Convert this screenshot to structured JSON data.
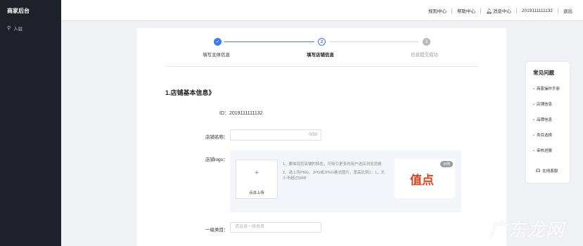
{
  "sidebar": {
    "brand": "商家后台",
    "nav_item": {
      "label": "入驻",
      "icon": "key-icon"
    }
  },
  "topbar": {
    "rules_center": "规则中心",
    "help_center": "帮助中心",
    "message_center": "消息中心",
    "user_phone": "2019111111132",
    "logout": "退出"
  },
  "steps": [
    {
      "index": "✓",
      "label": "填写主体信息",
      "status": "done"
    },
    {
      "index": "2",
      "label": "填写店铺信息",
      "status": "active"
    },
    {
      "index": "3",
      "label": "信息提交成功",
      "status": "pending"
    }
  ],
  "form": {
    "section_title": "1.店铺基本信息》",
    "id_label": "ID：",
    "id_value": "2019111111132",
    "shop_name_label": "店铺名称：",
    "shop_name_value": "",
    "shop_name_counter": "0/30",
    "logo_label": "店铺logo：",
    "upload_label": "点击上传",
    "upload_plus": "+",
    "tips": [
      "1、要体现您店铺的特色，可吸引更多的用户进店浏览消费",
      "2、请上传PNG、JPG或JPEG格式图片，宽高比例1：1，大小不超过5MB"
    ],
    "example_badge": "示例",
    "example_logo_text": "值点",
    "category_label": "一级类目：",
    "category_placeholder": "请选择一级类目"
  },
  "faq": {
    "title": "常见问题",
    "items": [
      "商家操作手册",
      "店铺信息",
      "品牌信息",
      "类目选择",
      "审核进展"
    ],
    "service": "在线客服"
  },
  "watermark": "广东龙网",
  "colors": {
    "accent": "#3b7cf6",
    "sidebar": "#1f2128",
    "logo_red": "#e8401c"
  }
}
